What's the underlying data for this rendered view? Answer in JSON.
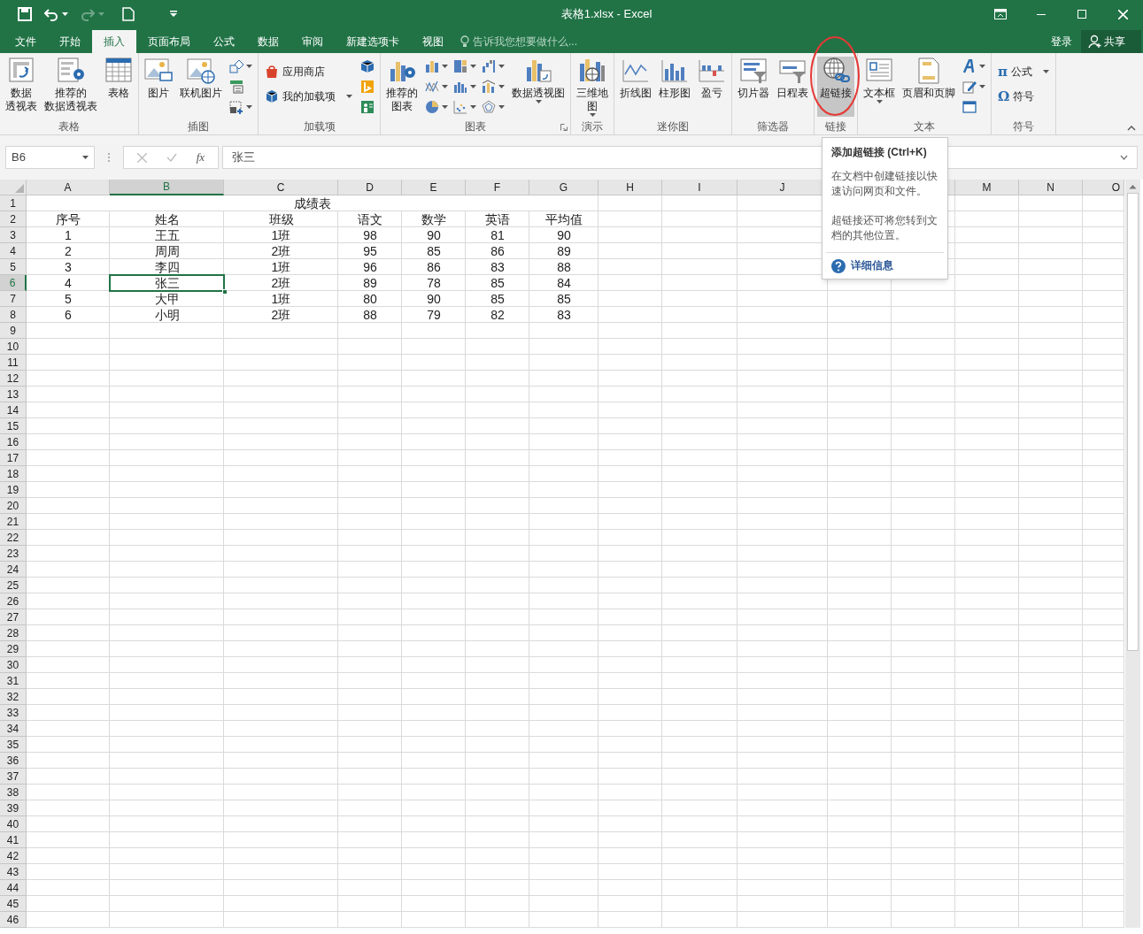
{
  "title_bar": {
    "title": "表格1.xlsx - Excel",
    "quick_access": [
      {
        "kind": "save",
        "disabled": false
      },
      {
        "kind": "undo",
        "disabled": false
      },
      {
        "kind": "redo",
        "disabled": true
      },
      {
        "kind": "new",
        "disabled": false
      },
      {
        "kind": "customize",
        "disabled": false
      }
    ]
  },
  "tabs": [
    {
      "label": "文件",
      "selected": false
    },
    {
      "label": "开始",
      "selected": false
    },
    {
      "label": "插入",
      "selected": true
    },
    {
      "label": "页面布局",
      "selected": false
    },
    {
      "label": "公式",
      "selected": false
    },
    {
      "label": "数据",
      "selected": false
    },
    {
      "label": "审阅",
      "selected": false
    },
    {
      "label": "新建选项卡",
      "selected": false
    },
    {
      "label": "视图",
      "selected": false
    }
  ],
  "tell_me": {
    "placeholder": "告诉我您想要做什么..."
  },
  "account": {
    "sign_in": "登录",
    "share": "共享"
  },
  "ribbon": {
    "groups": [
      {
        "label": "表格",
        "launcher": false,
        "items": [
          {
            "kind": "large",
            "lines": [
              "数据",
              "透视表"
            ],
            "dropdown": false,
            "highlighted": false
          },
          {
            "kind": "large",
            "lines": [
              "推荐的",
              "数据透视表"
            ],
            "dropdown": false,
            "highlighted": false
          },
          {
            "kind": "large",
            "lines": [
              "表格"
            ],
            "dropdown": false,
            "highlighted": false
          }
        ]
      },
      {
        "label": "插图",
        "launcher": false,
        "items": [
          {
            "kind": "large",
            "lines": [
              "图片"
            ],
            "dropdown": false,
            "highlighted": false
          },
          {
            "kind": "large",
            "lines": [
              "联机图片"
            ],
            "dropdown": false,
            "highlighted": false
          },
          {
            "kind": "icons"
          }
        ]
      },
      {
        "label": "加载项",
        "launcher": false,
        "items": [
          {
            "kind": "small_list",
            "entries": [
              {
                "label": "应用商店",
                "dropdown": false
              },
              {
                "label": "我的加载项",
                "dropdown": true
              }
            ]
          },
          {
            "kind": "icons"
          }
        ]
      },
      {
        "label": "图表",
        "launcher": true,
        "items": [
          {
            "kind": "large",
            "lines": [
              "推荐的",
              "图表"
            ],
            "dropdown": false,
            "highlighted": false
          },
          {
            "kind": "icon_grid"
          },
          {
            "kind": "large",
            "lines": [
              "数据透视图"
            ],
            "dropdown": true,
            "highlighted": false
          }
        ]
      },
      {
        "label": "演示",
        "launcher": false,
        "items": [
          {
            "kind": "large",
            "lines": [
              "三维地",
              "图"
            ],
            "dropdown": true,
            "highlighted": false
          }
        ]
      },
      {
        "label": "迷你图",
        "launcher": false,
        "items": [
          {
            "kind": "large",
            "lines": [
              "折线图"
            ],
            "dropdown": false,
            "highlighted": false
          },
          {
            "kind": "large",
            "lines": [
              "柱形图"
            ],
            "dropdown": false,
            "highlighted": false
          },
          {
            "kind": "large",
            "lines": [
              "盈亏"
            ],
            "dropdown": false,
            "highlighted": false
          }
        ]
      },
      {
        "label": "筛选器",
        "launcher": false,
        "items": [
          {
            "kind": "large",
            "lines": [
              "切片器"
            ],
            "dropdown": false,
            "highlighted": false
          },
          {
            "kind": "large",
            "lines": [
              "日程表"
            ],
            "dropdown": false,
            "highlighted": false
          }
        ]
      },
      {
        "label": "链接",
        "launcher": false,
        "items": [
          {
            "kind": "large",
            "lines": [
              "超链接"
            ],
            "dropdown": false,
            "highlighted": true
          }
        ]
      },
      {
        "label": "文本",
        "launcher": false,
        "items": [
          {
            "kind": "large",
            "lines": [
              "文本框"
            ],
            "dropdown": true,
            "highlighted": false
          },
          {
            "kind": "large",
            "lines": [
              "页眉和页脚"
            ],
            "dropdown": false,
            "highlighted": false
          },
          {
            "kind": "icons"
          }
        ]
      },
      {
        "label": "符号",
        "launcher": false,
        "items": [
          {
            "kind": "small_list",
            "entries": [
              {
                "symbol": "π",
                "label": "公式",
                "dropdown": true
              },
              {
                "symbol": "Ω",
                "label": "符号",
                "dropdown": false
              }
            ]
          }
        ]
      }
    ]
  },
  "formula_bar": {
    "name_box": "B6",
    "function_label": "fx",
    "value": "张三"
  },
  "sheet": {
    "title": "成绩表",
    "column_headers": [
      {
        "label": "A",
        "selected": false
      },
      {
        "label": "B",
        "selected": true
      },
      {
        "label": "C",
        "selected": false
      },
      {
        "label": "D",
        "selected": false
      },
      {
        "label": "E",
        "selected": false
      },
      {
        "label": "F",
        "selected": false
      },
      {
        "label": "G",
        "selected": false
      },
      {
        "label": "H",
        "selected": false
      },
      {
        "label": "I",
        "selected": false
      },
      {
        "label": "J",
        "selected": false
      },
      {
        "label": "M",
        "selected": false
      },
      {
        "label": "N",
        "selected": false
      },
      {
        "label": "O",
        "selected": false
      }
    ],
    "row_headers": [
      {
        "label": "1",
        "selected": false
      },
      {
        "label": "2",
        "selected": false
      },
      {
        "label": "3",
        "selected": false
      },
      {
        "label": "4",
        "selected": false
      },
      {
        "label": "5",
        "selected": false
      },
      {
        "label": "6",
        "selected": true
      },
      {
        "label": "7",
        "selected": false
      },
      {
        "label": "8",
        "selected": false
      },
      {
        "label": "9",
        "selected": false
      },
      {
        "label": "10",
        "selected": false
      },
      {
        "label": "11",
        "selected": false
      },
      {
        "label": "12",
        "selected": false
      },
      {
        "label": "13",
        "selected": false
      },
      {
        "label": "14",
        "selected": false
      },
      {
        "label": "15",
        "selected": false
      },
      {
        "label": "16",
        "selected": false
      },
      {
        "label": "17",
        "selected": false
      },
      {
        "label": "18",
        "selected": false
      },
      {
        "label": "19",
        "selected": false
      },
      {
        "label": "20",
        "selected": false
      },
      {
        "label": "21",
        "selected": false
      },
      {
        "label": "22",
        "selected": false
      },
      {
        "label": "23",
        "selected": false
      },
      {
        "label": "24",
        "selected": false
      },
      {
        "label": "25",
        "selected": false
      },
      {
        "label": "26",
        "selected": false
      },
      {
        "label": "27",
        "selected": false
      },
      {
        "label": "28",
        "selected": false
      },
      {
        "label": "29",
        "selected": false
      },
      {
        "label": "30",
        "selected": false
      },
      {
        "label": "31",
        "selected": false
      },
      {
        "label": "32",
        "selected": false
      },
      {
        "label": "33",
        "selected": false
      },
      {
        "label": "34",
        "selected": false
      },
      {
        "label": "35",
        "selected": false
      },
      {
        "label": "36",
        "selected": false
      },
      {
        "label": "37",
        "selected": false
      },
      {
        "label": "38",
        "selected": false
      },
      {
        "label": "39",
        "selected": false
      },
      {
        "label": "40",
        "selected": false
      },
      {
        "label": "41",
        "selected": false
      },
      {
        "label": "42",
        "selected": false
      },
      {
        "label": "43",
        "selected": false
      },
      {
        "label": "44",
        "selected": false
      },
      {
        "label": "45",
        "selected": false
      },
      {
        "label": "46",
        "selected": false
      }
    ],
    "rows": [
      [
        "序号",
        "姓名",
        "班级",
        "语文",
        "数学",
        "英语",
        "平均值"
      ],
      [
        "1",
        "王五",
        "1班",
        "98",
        "90",
        "81",
        "90"
      ],
      [
        "2",
        "周周",
        "2班",
        "95",
        "85",
        "86",
        "89"
      ],
      [
        "3",
        "李四",
        "1班",
        "96",
        "86",
        "83",
        "88"
      ],
      [
        "4",
        "张三",
        "2班",
        "89",
        "78",
        "85",
        "84"
      ],
      [
        "5",
        "大甲",
        "1班",
        "80",
        "90",
        "85",
        "85"
      ],
      [
        "6",
        "小明",
        "2班",
        "88",
        "79",
        "82",
        "83"
      ]
    ]
  },
  "tooltip": {
    "title": "添加超链接 (Ctrl+K)",
    "paragraphs": [
      "在文档中创建链接以快速访问网页和文件。",
      "超链接还可将您转到文档的其他位置。"
    ],
    "link": "详细信息"
  }
}
